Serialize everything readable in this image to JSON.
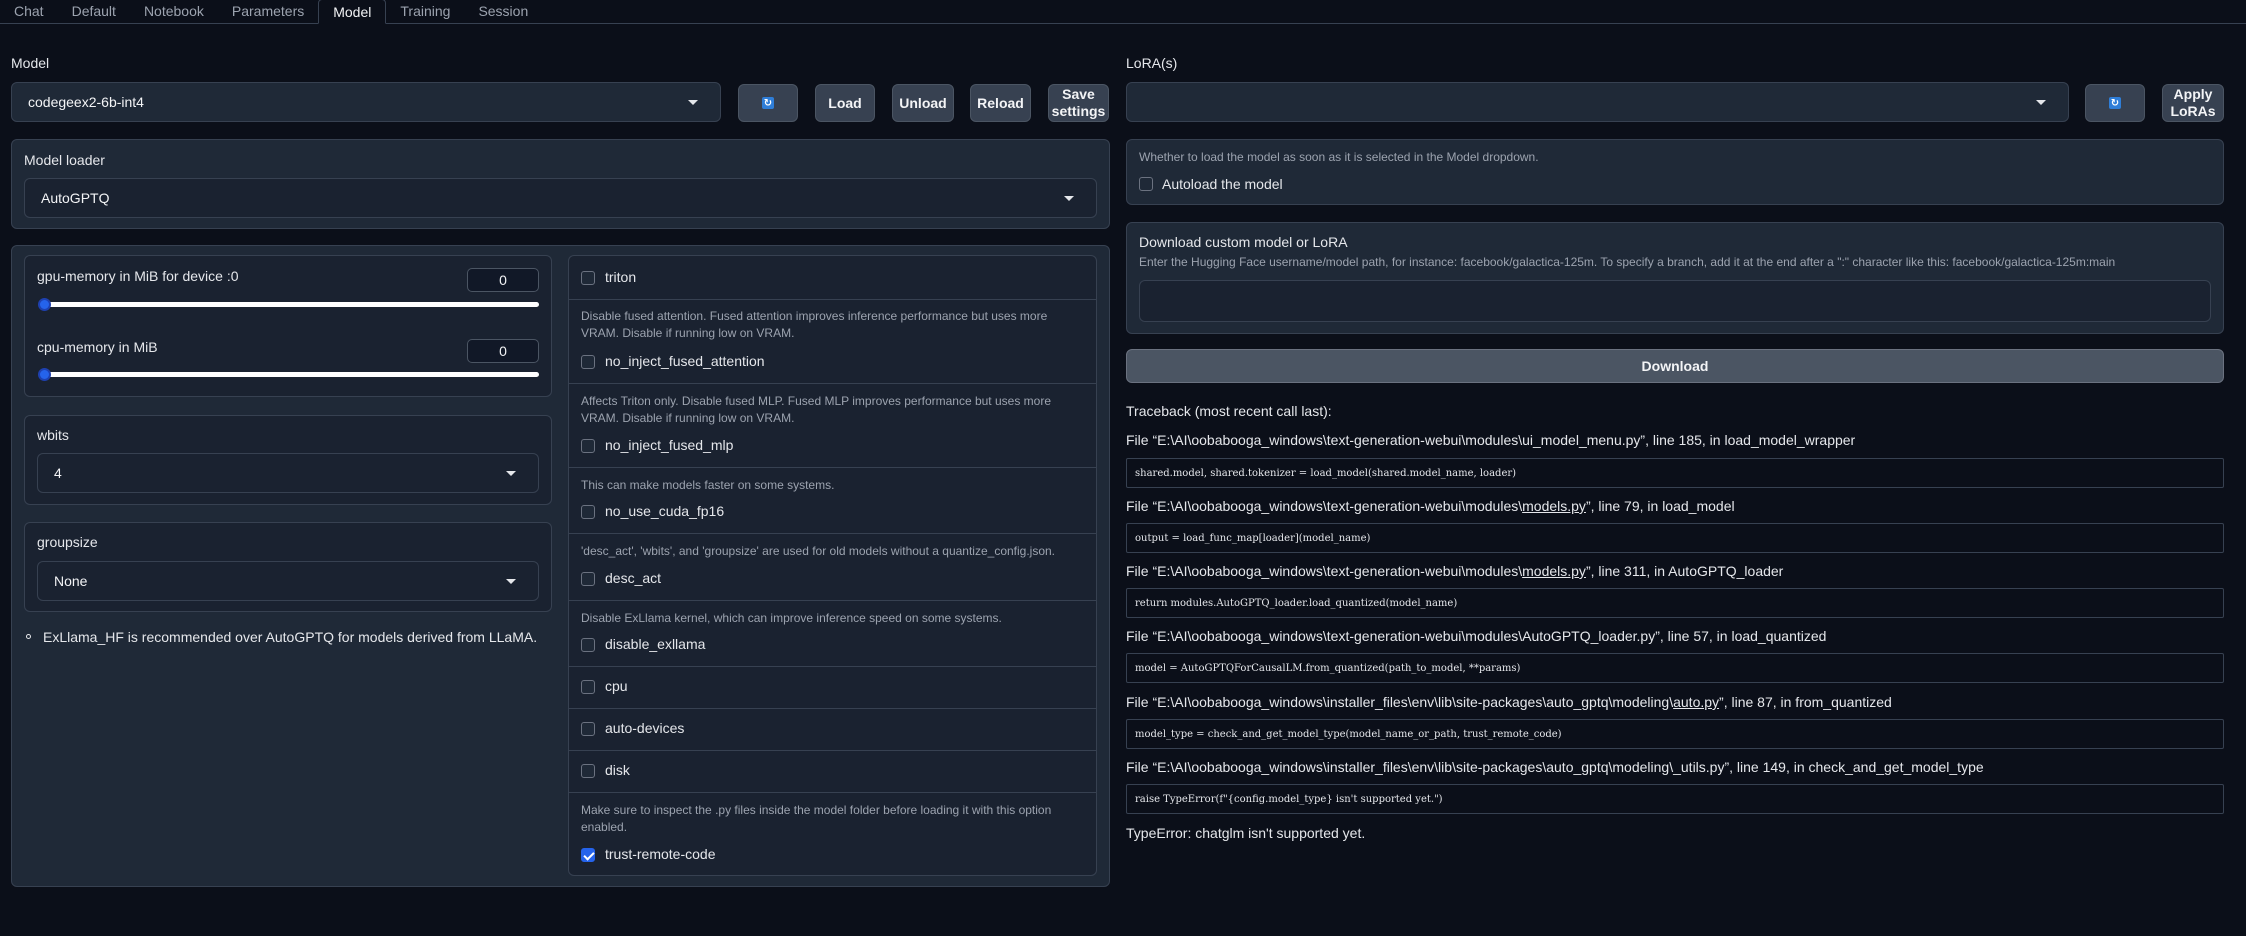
{
  "tabs": [
    "Chat",
    "Default",
    "Notebook",
    "Parameters",
    "Model",
    "Training",
    "Session"
  ],
  "active_tab": "Model",
  "model": {
    "label": "Model",
    "selected": "codegeex2-6b-int4",
    "buttons": {
      "refresh": "🔄",
      "load": "Load",
      "unload": "Unload",
      "reload": "Reload",
      "save": "Save settings"
    }
  },
  "lora": {
    "label": "LoRA(s)",
    "selected": "",
    "buttons": {
      "refresh": "🔄",
      "apply": "Apply LoRAs"
    }
  },
  "loader": {
    "label": "Model loader",
    "selected": "AutoGPTQ"
  },
  "gpu_memory": {
    "label": "gpu-memory in MiB for device :0",
    "value": "0",
    "fraction": 0
  },
  "cpu_memory": {
    "label": "cpu-memory in MiB",
    "value": "0",
    "fraction": 0
  },
  "wbits": {
    "label": "wbits",
    "selected": "4"
  },
  "groupsize": {
    "label": "groupsize",
    "selected": "None"
  },
  "note": "ExLlama_HF is recommended over AutoGPTQ for models derived from LLaMA.",
  "options": {
    "triton": {
      "label": "triton",
      "checked": false
    },
    "no_inject_fused_attention": {
      "info": "Disable fused attention. Fused attention improves inference performance but uses more VRAM. Disable if running low on VRAM.",
      "label": "no_inject_fused_attention",
      "checked": false
    },
    "no_inject_fused_mlp": {
      "info": "Affects Triton only. Disable fused MLP. Fused MLP improves performance but uses more VRAM. Disable if running low on VRAM.",
      "label": "no_inject_fused_mlp",
      "checked": false
    },
    "no_use_cuda_fp16": {
      "info": "This can make models faster on some systems.",
      "label": "no_use_cuda_fp16",
      "checked": false
    },
    "desc_act": {
      "info": "'desc_act', 'wbits', and 'groupsize' are used for old models without a quantize_config.json.",
      "label": "desc_act",
      "checked": false
    },
    "disable_exllama": {
      "info": "Disable ExLlama kernel, which can improve inference speed on some systems.",
      "label": "disable_exllama",
      "checked": false
    },
    "cpu": {
      "label": "cpu",
      "checked": false
    },
    "auto_devices": {
      "label": "auto-devices",
      "checked": false
    },
    "disk": {
      "label": "disk",
      "checked": false
    },
    "trust_remote_code": {
      "info": "Make sure to inspect the .py files inside the model folder before loading it with this option enabled.",
      "label": "trust-remote-code",
      "checked": true
    }
  },
  "autoload": {
    "info": "Whether to load the model as soon as it is selected in the Model dropdown.",
    "label": "Autoload the model",
    "checked": false
  },
  "download": {
    "title": "Download custom model or LoRA",
    "info": "Enter the Hugging Face username/model path, for instance: facebook/galactica-125m. To specify a branch, add it at the end after a \":\" character like this: facebook/galactica-125m:main",
    "value": "",
    "button": "Download"
  },
  "traceback": {
    "header": "Traceback (most recent call last):",
    "frames": [
      {
        "pre": "File “E:\\AI\\oobabooga_windows\\text-generation-webui\\modules\\",
        "link": "",
        "post": "ui_model_menu.py”, line 185, in load_model_wrapper",
        "code": "shared.model, shared.tokenizer = load_model(shared.model_name, loader)"
      },
      {
        "pre": "File “E:\\AI\\oobabooga_windows\\text-generation-webui\\modules\\",
        "link": "models.py",
        "post": "”, line 79, in load_model",
        "code": "output = load_func_map[loader](model_name)"
      },
      {
        "pre": "File “E:\\AI\\oobabooga_windows\\text-generation-webui\\modules\\",
        "link": "models.py",
        "post": "”, line 311, in AutoGPTQ_loader",
        "code": "return modules.AutoGPTQ_loader.load_quantized(model_name)"
      },
      {
        "pre": "File “E:\\AI\\oobabooga_windows\\text-generation-webui\\modules\\",
        "link": "",
        "post": "AutoGPTQ_loader.py”, line 57, in load_quantized",
        "code": "model = AutoGPTQForCausalLM.from_quantized(path_to_model, **params)"
      },
      {
        "pre": "File “E:\\AI\\oobabooga_windows\\installer_files\\env\\lib\\site-packages\\auto_gptq\\modeling\\",
        "link": "auto.py",
        "post": "”, line 87, in from_quantized",
        "code": "model_type = check_and_get_model_type(model_name_or_path, trust_remote_code)"
      },
      {
        "pre": "File “E:\\AI\\oobabooga_windows\\installer_files\\env\\lib\\site-packages\\auto_gptq\\modeling\\",
        "link": "",
        "post": "_utils.py”, line 149, in check_and_get_model_type",
        "code": "raise TypeError(f\"{config.model_type} isn't supported yet.\")"
      }
    ],
    "error": "TypeError: chatglm isn't supported yet."
  }
}
